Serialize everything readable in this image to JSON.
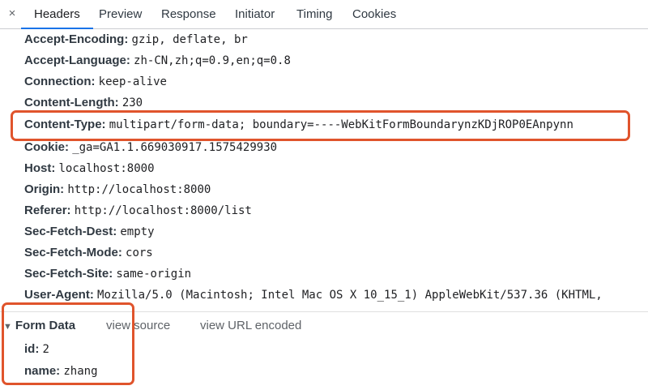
{
  "tabs": [
    "Headers",
    "Preview",
    "Response",
    "Initiator",
    "Timing",
    "Cookies"
  ],
  "close_glyph": "×",
  "headers": [
    {
      "name": "Accept-Encoding:",
      "value": "gzip, deflate, br"
    },
    {
      "name": "Accept-Language:",
      "value": "zh-CN,zh;q=0.9,en;q=0.8"
    },
    {
      "name": "Connection:",
      "value": "keep-alive"
    },
    {
      "name": "Content-Length:",
      "value": "230"
    },
    {
      "name": "Content-Type:",
      "value": "multipart/form-data; boundary=----WebKitFormBoundarynzKDjROP0EAnpynn"
    },
    {
      "name": "Cookie:",
      "value": "_ga=GA1.1.669030917.1575429930"
    },
    {
      "name": "Host:",
      "value": "localhost:8000"
    },
    {
      "name": "Origin:",
      "value": "http://localhost:8000"
    },
    {
      "name": "Referer:",
      "value": "http://localhost:8000/list"
    },
    {
      "name": "Sec-Fetch-Dest:",
      "value": "empty"
    },
    {
      "name": "Sec-Fetch-Mode:",
      "value": "cors"
    },
    {
      "name": "Sec-Fetch-Site:",
      "value": "same-origin"
    },
    {
      "name": "User-Agent:",
      "value": "Mozilla/5.0 (Macintosh; Intel Mac OS X 10_15_1) AppleWebKit/537.36 (KHTML,"
    }
  ],
  "form_data": {
    "title": "Form Data",
    "triangle": "▼",
    "view_source": "view source",
    "view_url_encoded": "view URL encoded",
    "fields": [
      {
        "name": "id:",
        "value": "2"
      },
      {
        "name": "name:",
        "value": "zhang"
      }
    ]
  },
  "colors": {
    "accent": "#1a73e8",
    "highlight": "#e0542c"
  }
}
